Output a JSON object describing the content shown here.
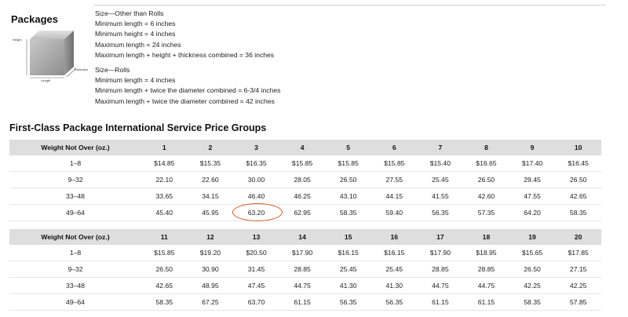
{
  "packages": {
    "title": "Packages",
    "diagram": {
      "height": "Height",
      "thickness": "Thickness",
      "length": "Length"
    },
    "other_than_rolls": [
      "Size—Other than Rolls",
      "Minimum length = 6 inches",
      "Minimum height = 4 inches",
      "Maximum length = 24 inches",
      "Maximum length + height + thickness combined = 36 inches"
    ],
    "rolls": [
      "Size—Rolls",
      "Minimum length = 4 inches",
      "Minimum length + twice the diameter combined = 6-3/4 inches",
      "Maximum length + twice the diameter combined = 42 inches"
    ]
  },
  "price_groups": {
    "title": "First-Class Package International Service Price Groups",
    "tables": [
      {
        "header": [
          "Weight Not Over (oz.)",
          "1",
          "2",
          "3",
          "4",
          "5",
          "6",
          "7",
          "8",
          "9",
          "10"
        ],
        "rows": [
          [
            "1–8",
            "$14.85",
            "$15.35",
            "$16.35",
            "$15.85",
            "$15.85",
            "$15.85",
            "$15.40",
            "$16.65",
            "$17.40",
            "$16.45"
          ],
          [
            "9–32",
            "22.10",
            "22.60",
            "30.00",
            "28.05",
            "26.50",
            "27.55",
            "25.45",
            "26.50",
            "29.45",
            "26.50"
          ],
          [
            "33–48",
            "33.65",
            "34.15",
            "46.40",
            "46.25",
            "43.10",
            "44.15",
            "41.55",
            "42.60",
            "47.55",
            "42.65"
          ],
          [
            "49–64",
            "45.40",
            "45.95",
            "63.20",
            "62.95",
            "58.35",
            "59.40",
            "56.35",
            "57.35",
            "64.20",
            "58.35"
          ]
        ]
      },
      {
        "header": [
          "Weight Not Over (oz.)",
          "11",
          "12",
          "13",
          "14",
          "15",
          "16",
          "17",
          "18",
          "19",
          "20"
        ],
        "rows": [
          [
            "1–8",
            "$15.85",
            "$19.20",
            "$20.50",
            "$17.90",
            "$16.15",
            "$16.15",
            "$17.90",
            "$18.95",
            "$15.65",
            "$17.85"
          ],
          [
            "9–32",
            "26.50",
            "30.90",
            "31.45",
            "28.85",
            "25.45",
            "25.45",
            "28.85",
            "28.85",
            "26.50",
            "27.15"
          ],
          [
            "33–48",
            "42.65",
            "48.95",
            "47.45",
            "44.75",
            "41.30",
            "41.30",
            "44.75",
            "44.75",
            "42.25",
            "42.25"
          ],
          [
            "49–64",
            "58.35",
            "67.25",
            "63.70",
            "61.15",
            "56.35",
            "56.35",
            "61.15",
            "61.15",
            "58.35",
            "57.85"
          ]
        ]
      }
    ]
  },
  "annotation": {
    "circled_value": "63.20",
    "color": "#d2582a"
  }
}
